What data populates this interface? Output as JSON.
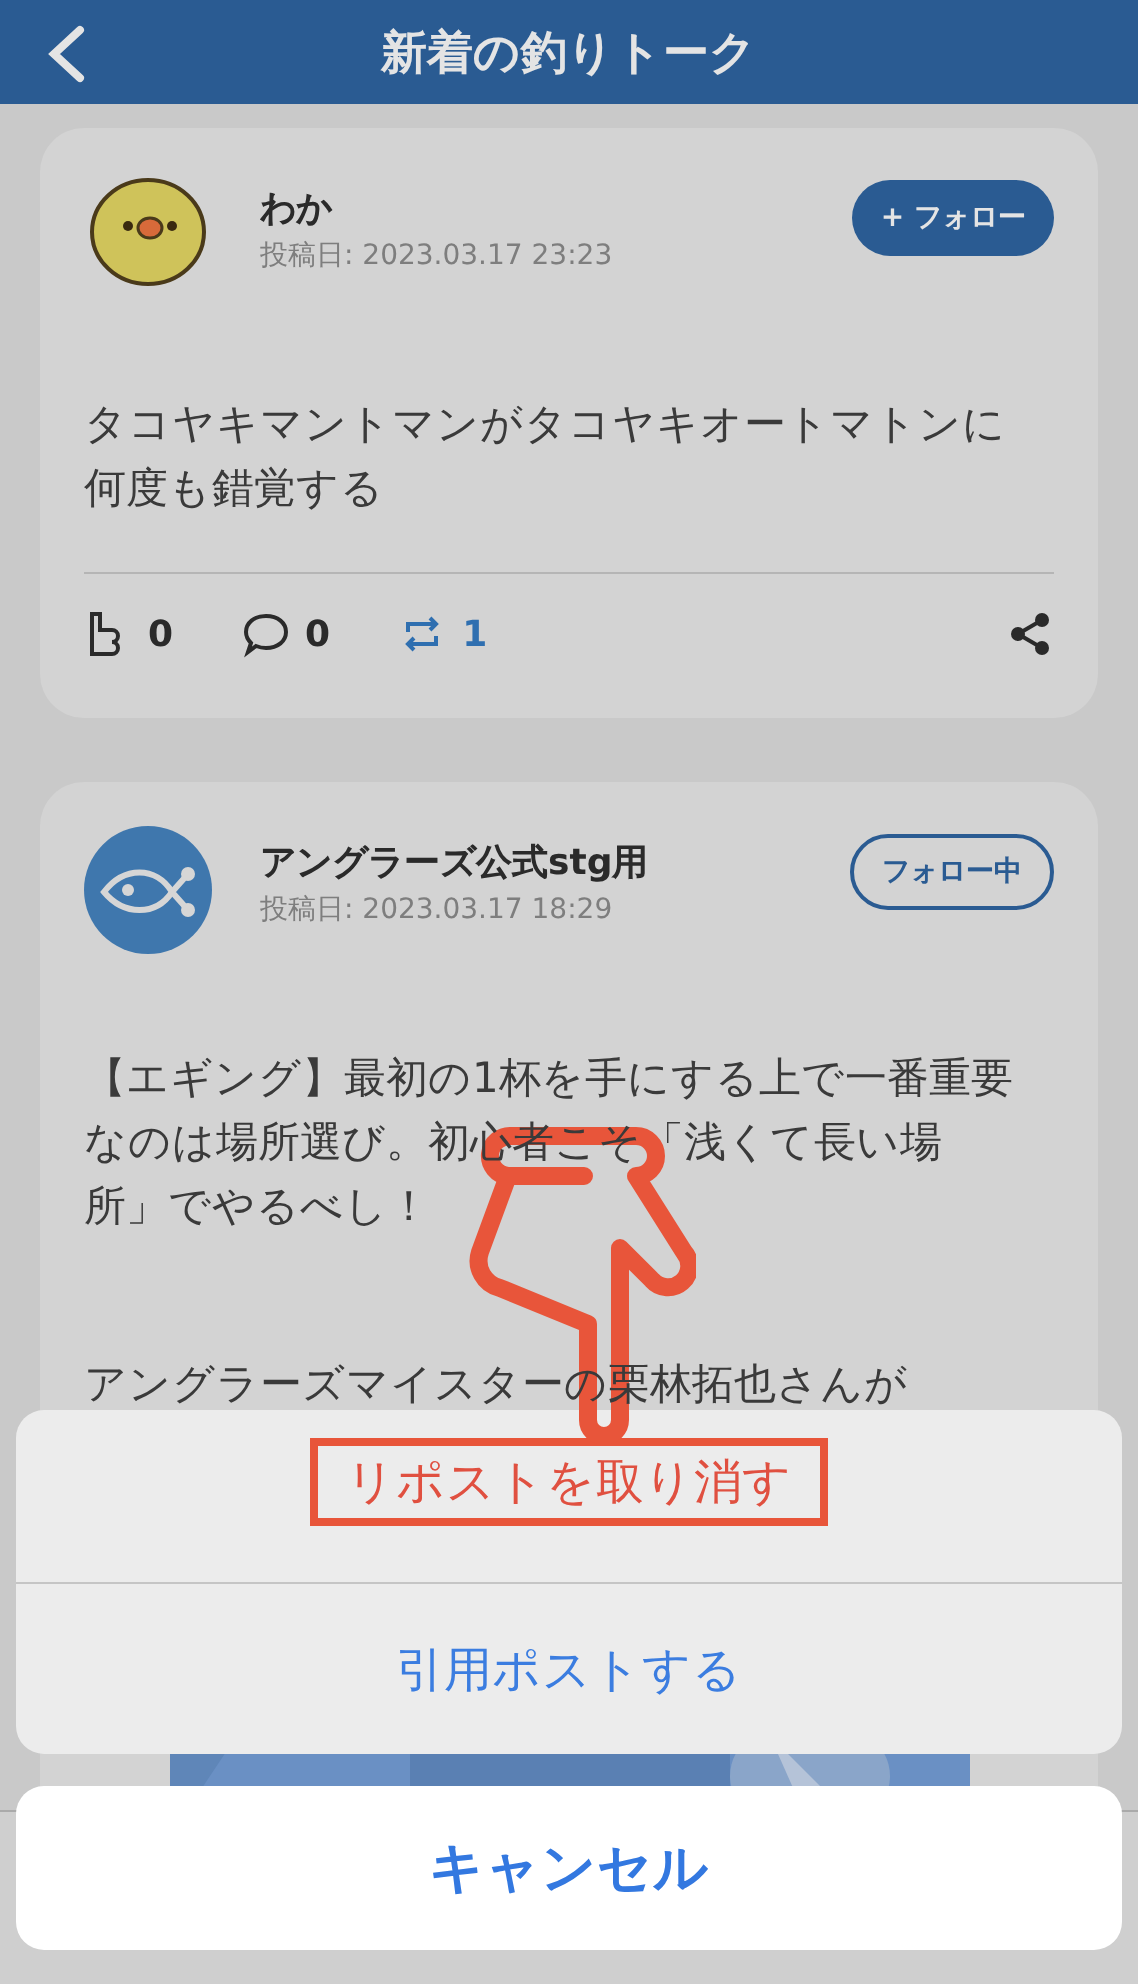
{
  "header": {
    "title": "新着の釣りトーク"
  },
  "posts": [
    {
      "author": "わか",
      "avatar": {
        "kind": "chick"
      },
      "date": "投稿日: 2023.03.17 23:23",
      "follow": {
        "label": "+ フォロー",
        "following": false
      },
      "paragraphs": [
        "タコヤキマントマンがタコヤキオートマトンに何度も錯覚する"
      ],
      "likes": "0",
      "comments": "0",
      "reposts": "1",
      "reposted": true
    },
    {
      "author": "アングラーズ公式stg用",
      "avatar": {
        "kind": "fish"
      },
      "date": "投稿日: 2023.03.17 18:29",
      "follow": {
        "label": "フォロー中",
        "following": true
      },
      "paragraphs": [
        "【エギング】最初の1杯を手にする上で一番重要なのは場所選び。初心者こそ「浅くて長い場所」でやるべし！",
        "アングラーズマイスターの栗林拓也さんが"
      ]
    }
  ],
  "action_sheet": {
    "actions": [
      {
        "label": "リポストを取り消す",
        "kind": "destructive",
        "highlighted": true
      },
      {
        "label": "引用ポストする",
        "kind": "default",
        "highlighted": false
      }
    ],
    "cancel": "キャンセル"
  }
}
